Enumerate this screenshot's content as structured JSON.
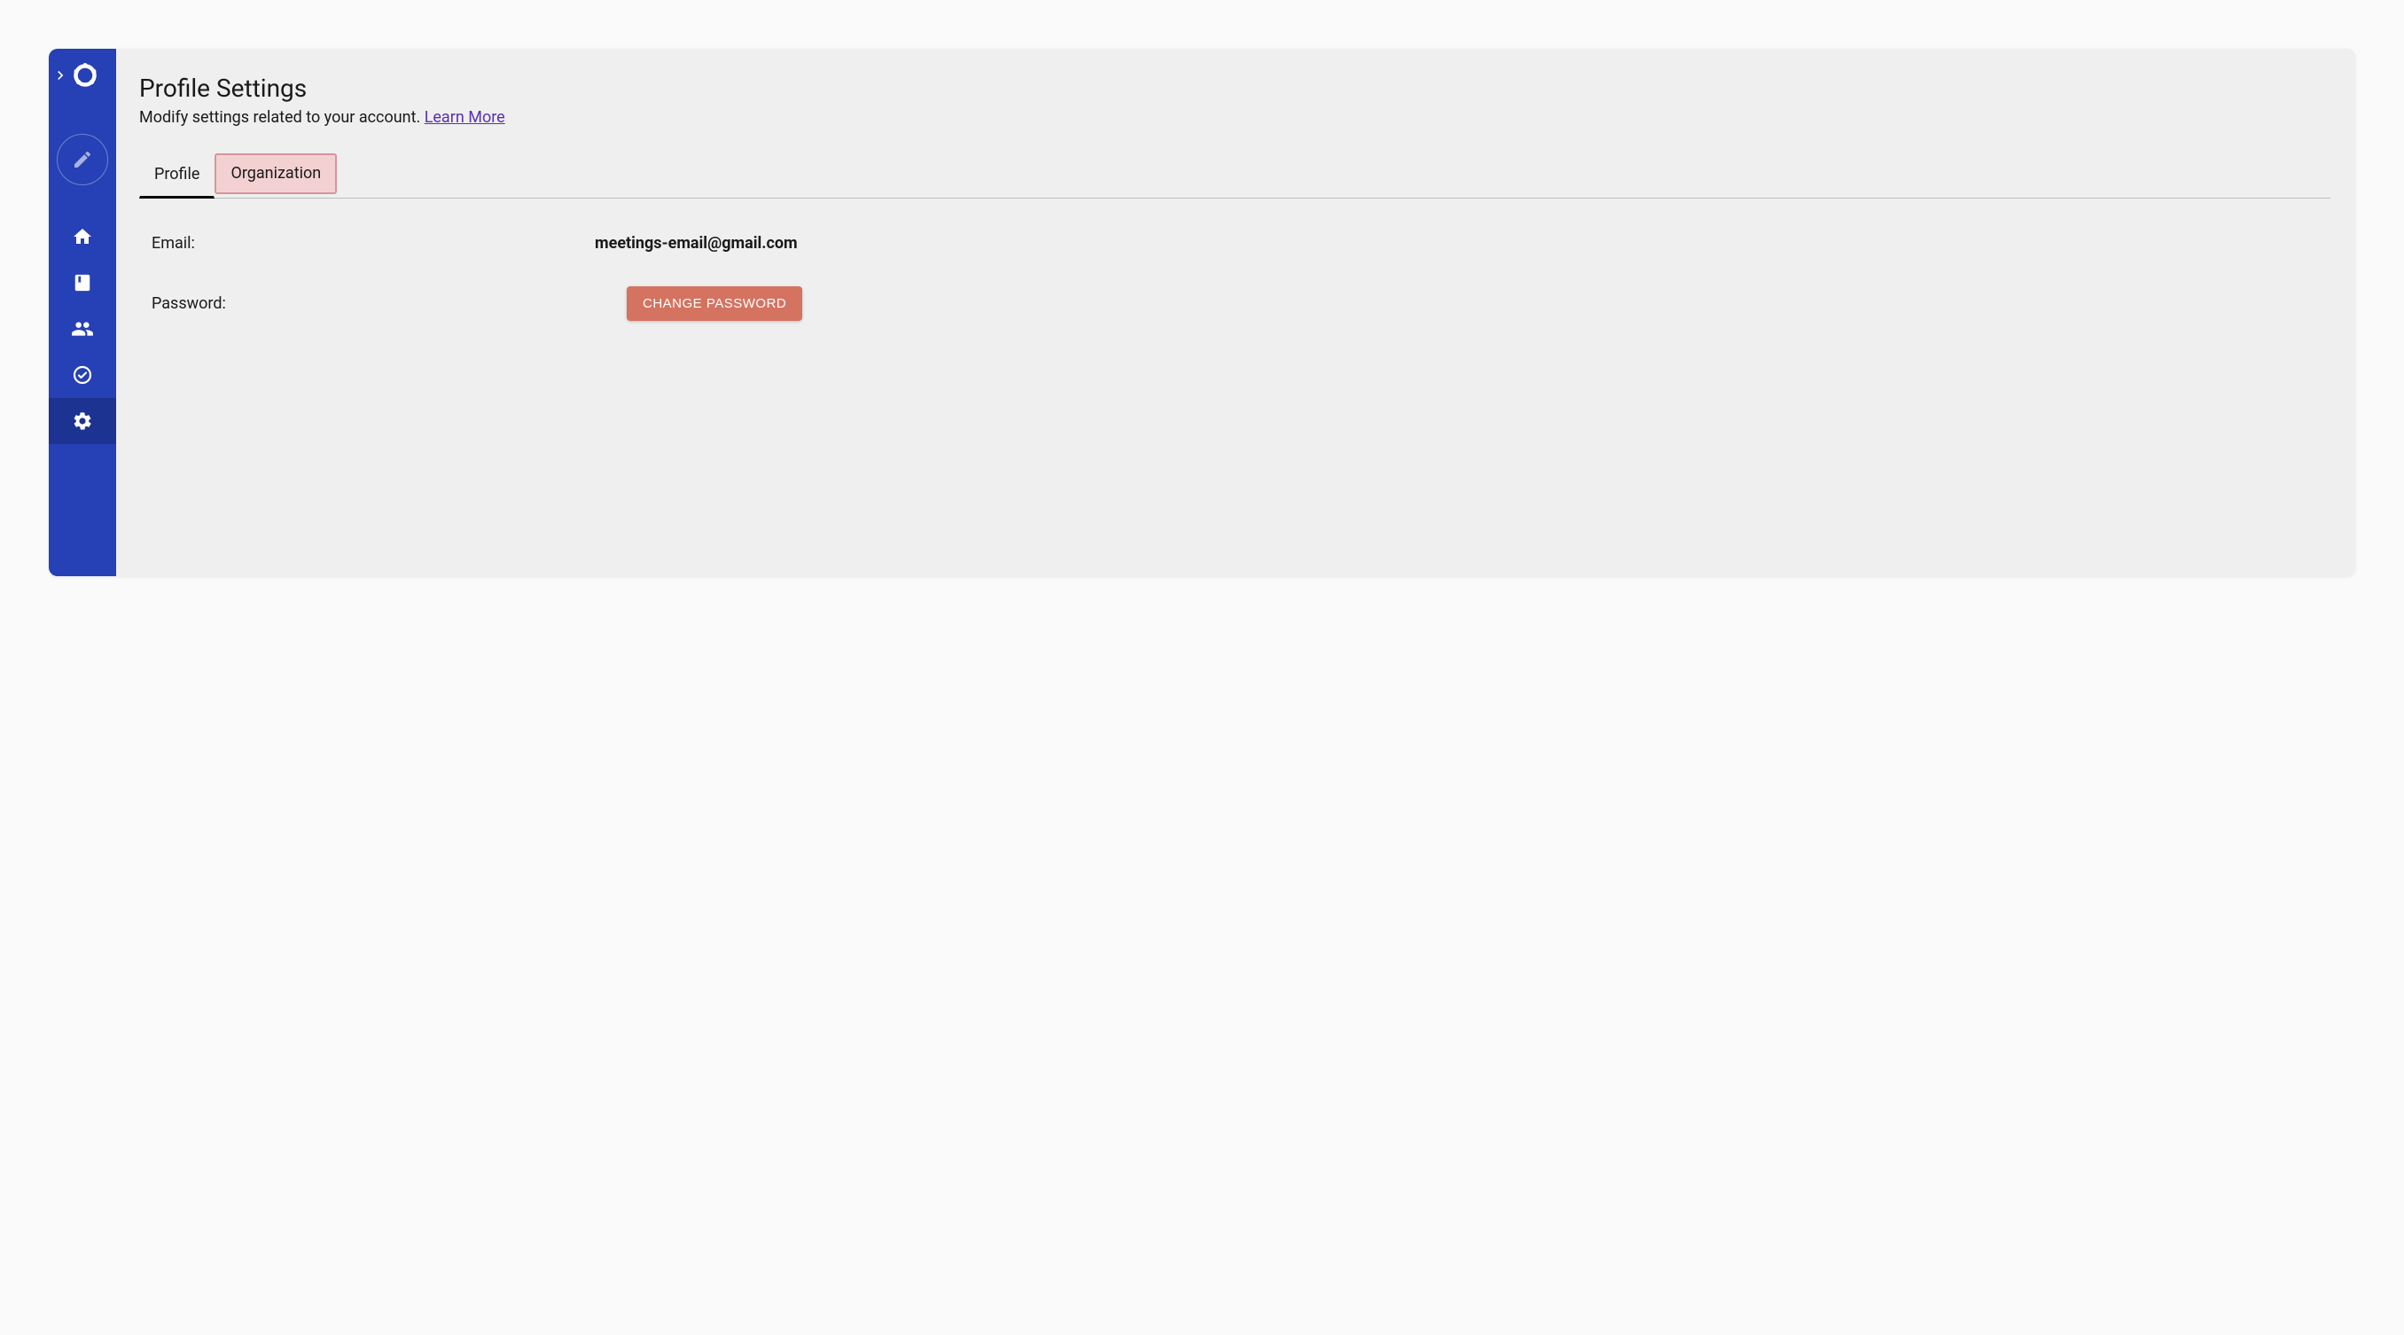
{
  "sidebar": {
    "items": [
      {
        "name": "home"
      },
      {
        "name": "book"
      },
      {
        "name": "people"
      },
      {
        "name": "check"
      },
      {
        "name": "settings",
        "active": true
      }
    ]
  },
  "page": {
    "title": "Profile Settings",
    "subtitle_prefix": "Modify settings related to your account. ",
    "learn_more": "Learn More"
  },
  "tabs": {
    "profile": "Profile",
    "organization": "Organization"
  },
  "profile": {
    "email_label": "Email:",
    "email_value": "meetings-email@gmail.com",
    "password_label": "Password:",
    "change_password_button": "CHANGE PASSWORD"
  }
}
